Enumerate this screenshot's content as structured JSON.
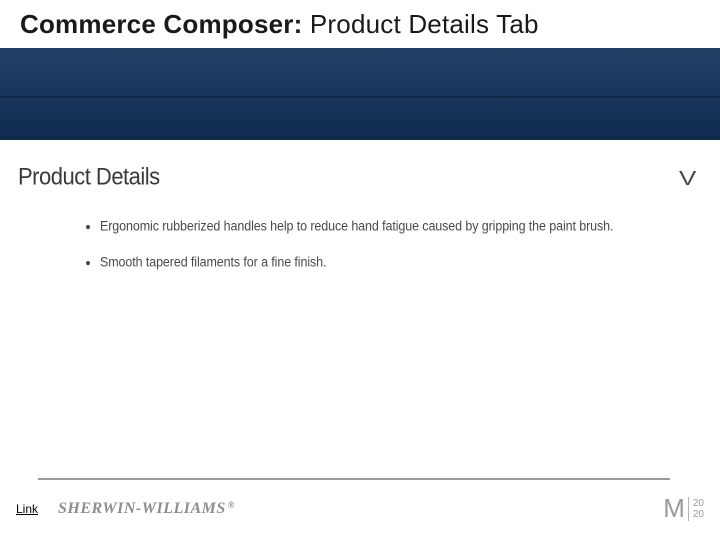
{
  "header": {
    "title_strong": "Commerce Composer: ",
    "title_rest": "Product Details Tab"
  },
  "panel": {
    "title": "Product Details",
    "chevron": "V",
    "bullets": [
      "Ergonomic rubberized handles help to reduce hand fatigue caused by gripping the paint brush.",
      "Smooth tapered filaments for a fine finish."
    ]
  },
  "footer": {
    "link_label": "Link",
    "brand": "SHERWIN-WILLIAMS",
    "reg": "®",
    "m2020_m": "M",
    "m2020_top": "20",
    "m2020_bottom": "20"
  }
}
